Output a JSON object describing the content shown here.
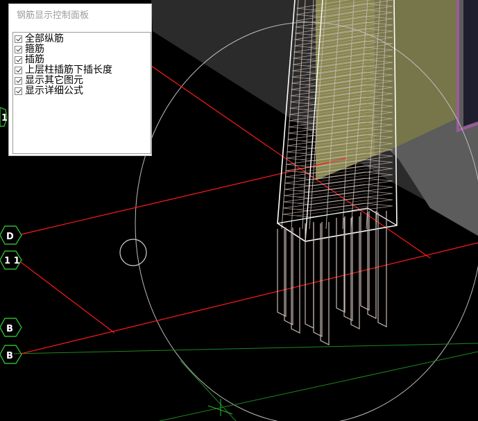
{
  "panel": {
    "title": "钢筋显示控制面板",
    "options": [
      {
        "label": "全部纵筋",
        "checked": true
      },
      {
        "label": "箍筋",
        "checked": true
      },
      {
        "label": "插筋",
        "checked": true
      },
      {
        "label": "上层柱插筋下插长度",
        "checked": true
      },
      {
        "label": "显示其它图元",
        "checked": true
      },
      {
        "label": "显示详细公式",
        "checked": true
      }
    ]
  },
  "axis_labels": {
    "left_partial": "1",
    "d": "D",
    "one_one": "1 1",
    "b_upper": "B",
    "b_lower": "B"
  },
  "colors": {
    "axis_line": "#ff1a1a",
    "axis_bubble": "#2fb52f",
    "grid_green": "#1c8a1c",
    "rebar": "#c9b8b0",
    "column_outline": "#ffffff",
    "wall_face": "#878653",
    "wall_top": "#5a5a5a",
    "panel_title": "#9c9c9c"
  }
}
